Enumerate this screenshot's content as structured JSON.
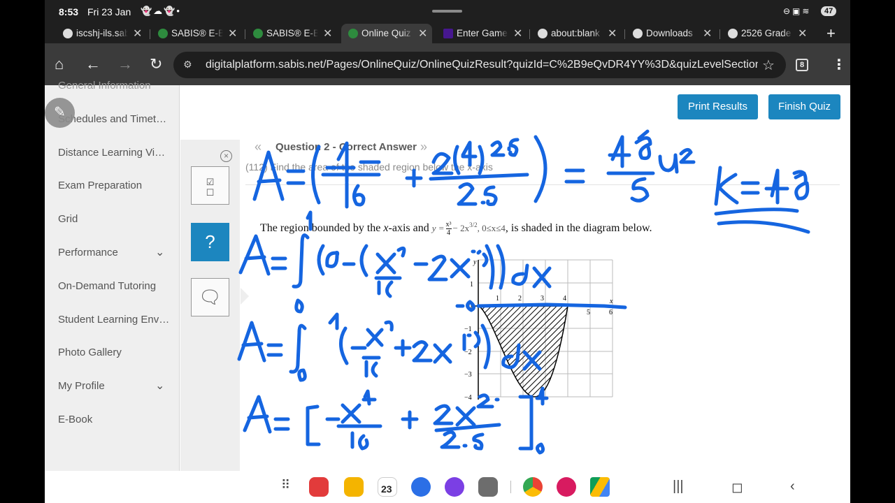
{
  "status_bar": {
    "time": "8:53",
    "date": "Fri 23 Jan",
    "battery": "47"
  },
  "tabs": [
    {
      "label": "iscshj-ils.sab",
      "icon": "globe-icon",
      "active": false
    },
    {
      "label": "SABIS® E-Bo",
      "icon": "sabis-icon",
      "active": false
    },
    {
      "label": "SABIS® E-Bo",
      "icon": "sabis-icon",
      "active": false
    },
    {
      "label": "Online Quiz",
      "icon": "sabis-icon",
      "active": true
    },
    {
      "label": "Enter Game",
      "icon": "kahoot-icon",
      "active": false
    },
    {
      "label": "about:blank",
      "icon": "chrome-icon",
      "active": false
    },
    {
      "label": "Downloads",
      "icon": "chrome-icon",
      "active": false
    },
    {
      "label": "2526 Grade",
      "icon": "chrome-icon",
      "active": false
    }
  ],
  "toolbar": {
    "url": "digitalplatform.sabis.net/Pages/OnlineQuiz/OnlineQuizResult?quizId=C%2B9eQvDR4YY%3D&quizLevelSectionId",
    "tab_count": "8"
  },
  "sidebar": {
    "items": [
      {
        "label": "General Information",
        "expandable": false
      },
      {
        "label": "Schedules and Timet…",
        "expandable": false
      },
      {
        "label": "Distance Learning Vi…",
        "expandable": false
      },
      {
        "label": "Exam Preparation",
        "expandable": false
      },
      {
        "label": "Grid",
        "expandable": false
      },
      {
        "label": "Performance",
        "expandable": true
      },
      {
        "label": "On-Demand Tutoring",
        "expandable": false
      },
      {
        "label": "Student Learning Env…",
        "expandable": false
      },
      {
        "label": "Photo Gallery",
        "expandable": false
      },
      {
        "label": "My Profile",
        "expandable": true
      },
      {
        "label": "E-Book",
        "expandable": false
      }
    ]
  },
  "actions": {
    "print": "Print Results",
    "finish": "Finish Quiz"
  },
  "question": {
    "title": "Question 2 - Correct Answer",
    "subtitle": "(112) Find the area of the shaded region below the x-axis",
    "body_pre": "The region bounded by the ",
    "body_x": "x",
    "body_mid": "-axis and",
    "func_lhs": "y =",
    "frac_num": "x³",
    "frac_den": "4",
    "func_rhs": "− 2x",
    "func_exp": "3/2",
    "domain": ", 0≤x≤4",
    "body_post": ", is shaded in the diagram below."
  },
  "graph": {
    "x_ticks": [
      "1",
      "2",
      "3",
      "4",
      "5",
      "6"
    ],
    "y_ticks": [
      "1",
      "0",
      "−1",
      "−2",
      "−3",
      "−4"
    ],
    "x_label": "x",
    "y_label": "y",
    "curve_min": -4
  },
  "colors": {
    "accent": "#1c86bf",
    "ink": "#1565e0",
    "sidebar": "#efefef"
  }
}
